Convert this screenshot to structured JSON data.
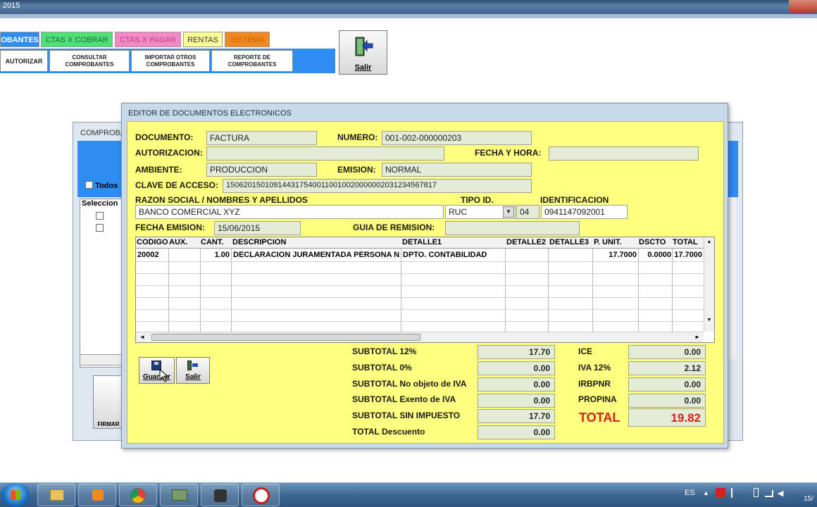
{
  "window": {
    "title": "2015"
  },
  "top_tabs": [
    "OBANTES",
    "CTAS X COBRAR",
    "CTAS X PAGAR",
    "RENTAS",
    "SISTEMA"
  ],
  "sub_buttons": [
    "AUTORIZAR",
    "CONSULTAR COMPROBANTES",
    "IMPORTAR OTROS COMPROBANTES",
    "REPORTE DE COMPROBANTES"
  ],
  "salir_main": "Salir",
  "background_window": {
    "title": "COMPROBA",
    "todos_label": "Todos",
    "seleccion_header": "Seleccion",
    "firmar_label": "FIRMAR"
  },
  "dialog": {
    "title": "EDITOR DE DOCUMENTOS ELECTRONICOS",
    "labels": {
      "documento": "DOCUMENTO:",
      "numero": "NUMERO:",
      "autorizacion": "AUTORIZACION:",
      "fecha_hora": "FECHA Y HORA:",
      "ambiente": "AMBIENTE:",
      "emision": "EMISION:",
      "clave": "CLAVE DE ACCESO:",
      "razon": "RAZON SOCIAL / NOMBRES Y APELLIDOS",
      "tipo_id": "TIPO ID.",
      "identificacion": "IDENTIFICACION",
      "fecha_emision": "FECHA EMISION:",
      "guia": "GUIA DE REMISION:"
    },
    "values": {
      "documento": "FACTURA",
      "numero": "001-002-000000203",
      "autorizacion": "",
      "fecha_hora": "",
      "ambiente": "PRODUCCION",
      "emision": "NORMAL",
      "clave": "1506201501091443175400110010020000002031234567817",
      "razon": "BANCO COMERCIAL XYZ",
      "tipo_id": "RUC",
      "tipo_id_code": "04",
      "identificacion": "0941147092001",
      "fecha_emision": "15/06/2015",
      "guia": ""
    },
    "grid": {
      "columns": [
        "CODIGO",
        "AUX.",
        "CANT.",
        "DESCRIPCION",
        "DETALLE1",
        "DETALLE2",
        "DETALLE3",
        "P. UNIT.",
        "DSCTO",
        "TOTAL"
      ],
      "rows": [
        {
          "codigo": "20002",
          "aux": "",
          "cant": "1.00",
          "descripcion": "DECLARACION JURAMENTADA PERSONA NA",
          "detalle1": "DPTO. CONTABILIDAD",
          "detalle2": "",
          "detalle3": "",
          "punit": "17.7000",
          "dscto": "0.0000",
          "total": "17.7000"
        }
      ]
    },
    "buttons": {
      "guardar": "Guardar",
      "salir": "Salir"
    },
    "totals_left": [
      {
        "label": "SUBTOTAL 12%",
        "value": "17.70"
      },
      {
        "label": "SUBTOTAL 0%",
        "value": "0.00"
      },
      {
        "label": "SUBTOTAL No objeto de IVA",
        "value": "0.00"
      },
      {
        "label": "SUBTOTAL Exento de IVA",
        "value": "0.00"
      },
      {
        "label": "SUBTOTAL SIN IMPUESTO",
        "value": "17.70"
      },
      {
        "label": "TOTAL Descuento",
        "value": "0.00"
      }
    ],
    "totals_right": [
      {
        "label": "ICE",
        "value": "0.00"
      },
      {
        "label": "IVA 12%",
        "value": "2.12"
      },
      {
        "label": "IRBPNR",
        "value": "0.00"
      },
      {
        "label": "PROPINA",
        "value": "0.00"
      }
    ],
    "grand_total": {
      "label": "TOTAL",
      "value": "19.82"
    }
  },
  "taskbar": {
    "language": "ES",
    "clock": "15/"
  },
  "colors": {
    "dialog_bg": "#ffff80",
    "menu_blue": "#2f8cf0",
    "total_red": "#d42020"
  }
}
